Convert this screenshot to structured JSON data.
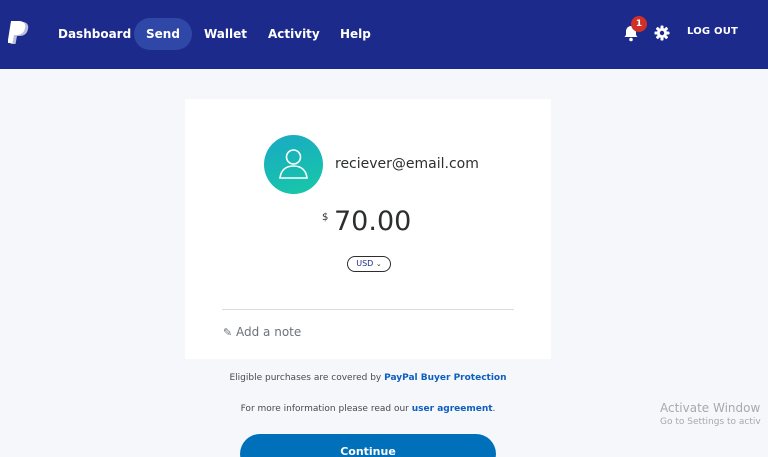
{
  "nav": {
    "items": [
      {
        "label": "Dashboard",
        "active": false
      },
      {
        "label": "Send",
        "active": true
      },
      {
        "label": "Wallet",
        "active": false
      },
      {
        "label": "Activity",
        "active": false
      },
      {
        "label": "Help",
        "active": false
      }
    ],
    "notification_count": "1",
    "logout_label": "LOG OUT",
    "icons": [
      "paypal-logo-icon",
      "bell-icon",
      "gear-icon"
    ]
  },
  "send": {
    "recipient": "reciever@email.com",
    "currency_symbol": "$",
    "amount": "70.00",
    "currency": "USD",
    "note_placeholder": "Add a note"
  },
  "info": {
    "protection_text": "Eligible purchases are covered by",
    "protection_link": "PayPal Buyer Protection",
    "agreement_text": "For more information please read our",
    "agreement_link": "user agreement",
    "agreement_end": "."
  },
  "continue_label": "Continue",
  "watermark": {
    "line1": "Activate Window",
    "line2": "Go to Settings to activ"
  },
  "colors": {
    "header": "#1b2a8b",
    "active_tab": "#2f47a7",
    "button": "#0070ba",
    "link": "#0e5fbf",
    "badge": "#d03027"
  }
}
